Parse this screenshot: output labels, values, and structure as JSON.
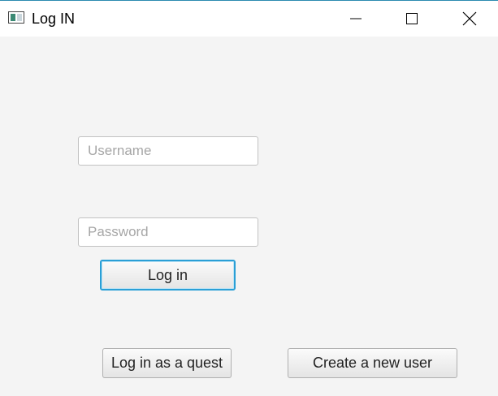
{
  "window": {
    "title": "Log IN",
    "icon": "app-window-icon",
    "controls": {
      "minimize": "minimize-icon",
      "maximize": "maximize-icon",
      "close": "close-icon"
    }
  },
  "form": {
    "username_placeholder": "Username",
    "password_placeholder": "Password",
    "login_label": "Log in"
  },
  "footer": {
    "guest_label": "Log in as a quest",
    "create_label": "Create a new user"
  },
  "colors": {
    "background": "#f4f4f4",
    "titlebar": "#ffffff",
    "focus_accent": "#2a9fd6"
  }
}
